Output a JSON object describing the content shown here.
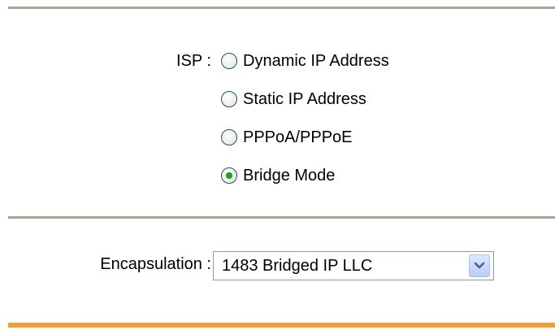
{
  "isp": {
    "label": "ISP :",
    "options": [
      {
        "label": "Dynamic IP Address",
        "selected": false
      },
      {
        "label": "Static IP Address",
        "selected": false
      },
      {
        "label": "PPPoA/PPPoE",
        "selected": false
      },
      {
        "label": "Bridge Mode",
        "selected": true
      }
    ]
  },
  "encapsulation": {
    "label": "Encapsulation :",
    "value": "1483 Bridged IP LLC",
    "icon": "chevron-down-icon"
  },
  "colors": {
    "divider": "#a8a398",
    "bottom_rule": "#f39a3b",
    "radio_selected_dot": "#21a121",
    "radio_border": "#1c5180",
    "select_border": "#7f9db9",
    "dropdown_button": "#b7ccf7"
  }
}
